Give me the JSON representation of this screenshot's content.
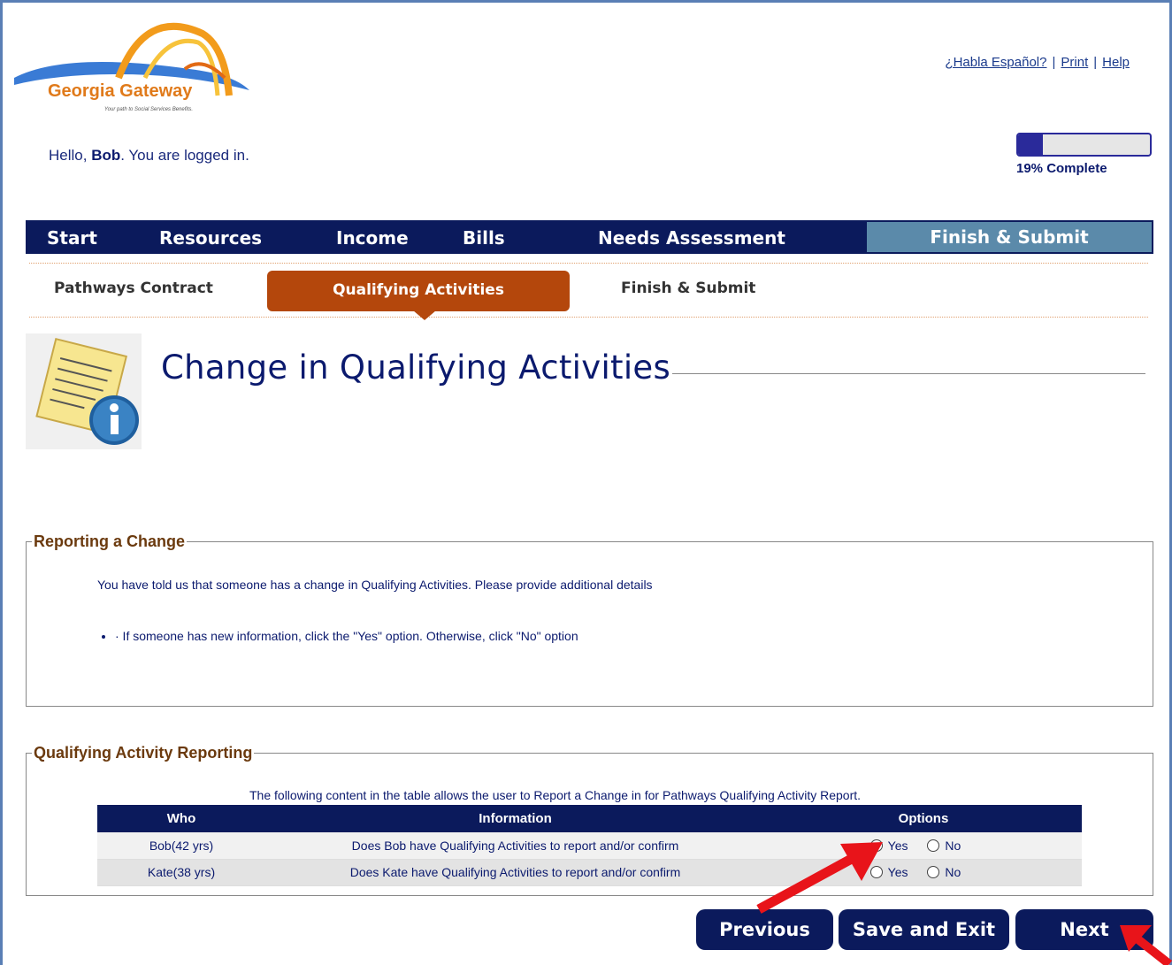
{
  "header": {
    "logo": {
      "brand": "Georgia Gateway",
      "tagline": "Your path to Social Services Benefits."
    },
    "links": [
      "¿Habla Español?",
      "Print",
      "Help"
    ],
    "greeting_prefix": "Hello, ",
    "user_name": "Bob",
    "greeting_suffix": ". You are logged in.",
    "progress": {
      "percent": 19,
      "label": "19% Complete"
    }
  },
  "main_nav": [
    "Start",
    "Resources",
    "Income",
    "Bills",
    "Needs Assessment",
    "Finish & Submit"
  ],
  "sub_nav": {
    "items": [
      "Pathways Contract",
      "Qualifying Activities",
      "Finish & Submit"
    ],
    "active": "Qualifying Activities"
  },
  "page": {
    "title": "Change in Qualifying Activities"
  },
  "reporting_change": {
    "legend": "Reporting a Change",
    "description": "You have told us that someone has a change in Qualifying Activities. Please provide additional details",
    "bullet": "· If someone has new information, click the \"Yes\" option. Otherwise, click \"No\" option"
  },
  "qa_reporting": {
    "legend": "Qualifying Activity Reporting",
    "caption": "The following content in the table allows the user to Report a Change in for Pathways Qualifying Activity Report.",
    "headers": [
      "Who",
      "Information",
      "Options"
    ],
    "rows": [
      {
        "who": "Bob(42 yrs)",
        "info": "Does Bob have Qualifying Activities to report and/or confirm",
        "yes": "Yes",
        "no": "No",
        "selected": "Yes"
      },
      {
        "who": "Kate(38 yrs)",
        "info": "Does Kate have Qualifying Activities to report and/or confirm",
        "yes": "Yes",
        "no": "No",
        "selected": ""
      }
    ]
  },
  "buttons": {
    "previous": "Previous",
    "save_exit": "Save and Exit",
    "next": "Next"
  },
  "colors": {
    "navy": "#0b1a5c",
    "active_tab": "#b4470c",
    "finish_tab": "#5b8aaa",
    "legend": "#6b3a0e",
    "annotation_arrow": "#e8141a"
  }
}
